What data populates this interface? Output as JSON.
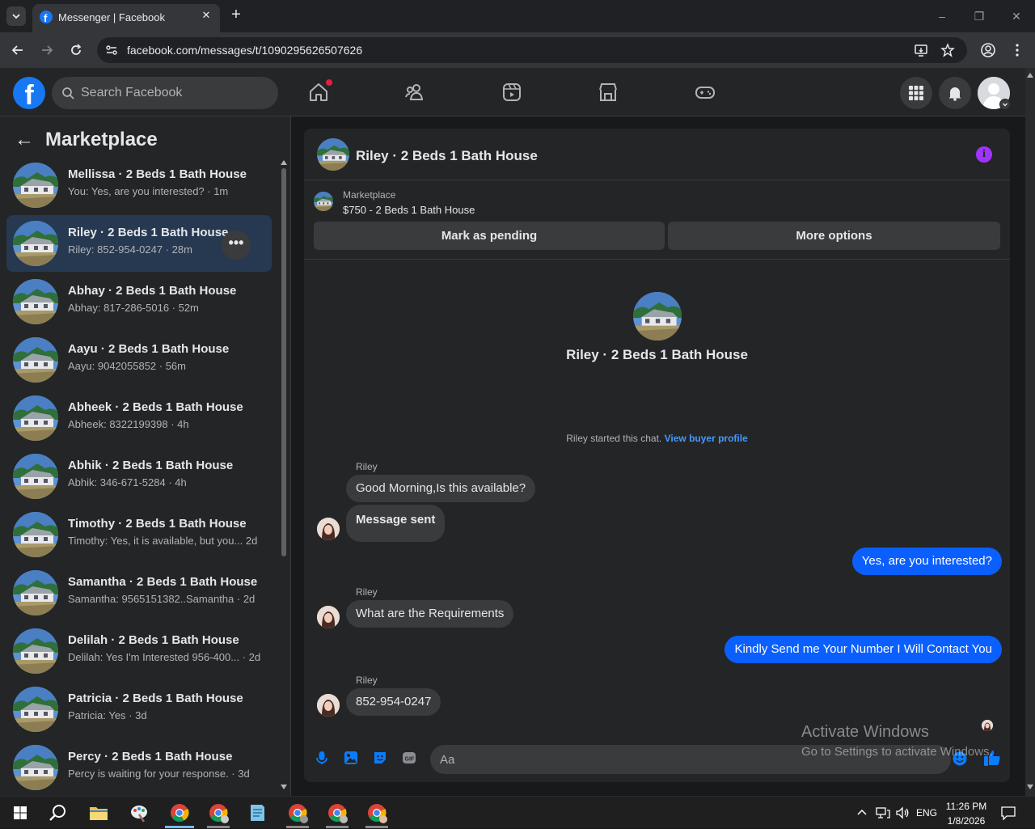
{
  "browser": {
    "tab_title": "Messenger | Facebook",
    "close_glyph": "✕",
    "new_tab_glyph": "+",
    "url": "facebook.com/messages/t/1090295626507626",
    "window_controls": [
      "–",
      "❐",
      "✕"
    ]
  },
  "fb": {
    "logo_letter": "f",
    "search_placeholder": "Search Facebook",
    "accent": "#1877f2"
  },
  "sidebar": {
    "back_glyph": "←",
    "title": "Marketplace",
    "more_glyph": "•••",
    "conversations": [
      {
        "name": "Mellissa · 2 Beds 1 Bath House",
        "preview": "You: Yes, are you interested? · 1m"
      },
      {
        "name": "Riley · 2 Beds 1 Bath House",
        "preview": "Riley: 852-954-0247 · 28m"
      },
      {
        "name": "Abhay · 2 Beds 1 Bath House",
        "preview": "Abhay: 817-286-5016 · 52m"
      },
      {
        "name": "Aayu · 2 Beds 1 Bath House",
        "preview": "Aayu: 9042055852 · 56m"
      },
      {
        "name": "Abheek · 2 Beds 1 Bath House",
        "preview": "Abheek: 8322199398 · 4h"
      },
      {
        "name": "Abhik · 2 Beds 1 Bath House",
        "preview": "Abhik: 346-671-5284 · 4h"
      },
      {
        "name": "Timothy · 2 Beds 1 Bath House",
        "preview": "Timothy: Yes, it is available, but you... 2d"
      },
      {
        "name": "Samantha · 2 Beds 1 Bath House",
        "preview": "Samantha: 9565151382..Samantha · 2d"
      },
      {
        "name": "Delilah · 2 Beds 1 Bath House",
        "preview": "Delilah: Yes I'm Interested 956-400... · 2d"
      },
      {
        "name": "Patricia · 2 Beds 1 Bath House",
        "preview": "Patricia: Yes · 3d"
      },
      {
        "name": "Percy · 2 Beds 1 Bath House",
        "preview": "Percy is waiting for your response. · 3d"
      }
    ]
  },
  "chat": {
    "title": "Riley · 2 Beds 1 Bath House",
    "info_glyph": "i",
    "listing_category": "Marketplace",
    "listing_price": "$750 - 2 Beds 1 Bath House",
    "mark_pending": "Mark as pending",
    "more_options": "More options",
    "hero_name": "Riley · 2 Beds 1 Bath House",
    "started_text": "Riley started this chat. ",
    "view_profile": "View buyer profile",
    "messages": {
      "sender": "Riley",
      "m1": "Good Morning,Is this available?",
      "m2": "Message sent",
      "out1": "Yes, are you interested?",
      "m3": "What are the Requirements",
      "out2": "Kindly Send me Your Number I Will Contact You",
      "m4": "852-954-0247"
    },
    "composer_placeholder": "Aa",
    "accent": "#0a5ffe"
  },
  "watermark": {
    "line1": "Activate Windows",
    "line2": "Go to Settings to activate Windows."
  },
  "taskbar": {
    "time": "11:26 PM",
    "date": "1/8/2026",
    "lang": "ENG"
  }
}
